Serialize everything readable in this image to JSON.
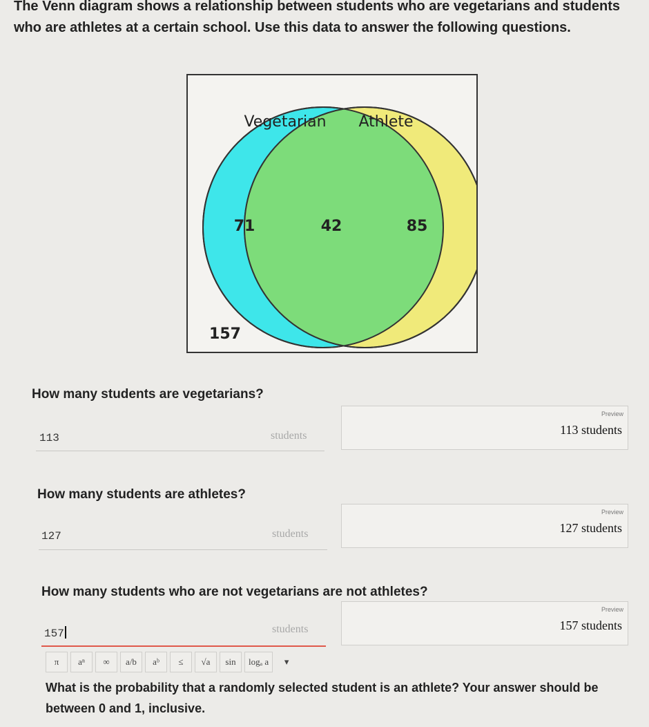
{
  "intro": "The Venn diagram shows a relationship between students who are vegetarians and students who are athletes at a certain school. Use this data to answer the following questions.",
  "venn": {
    "set_a_label": "Vegetarian",
    "set_b_label": "Athlete",
    "only_a": "71",
    "both": "42",
    "only_b": "85",
    "neither": "157",
    "color_a": "#3ee6ea",
    "color_b": "#f0ea7a",
    "color_overlap": "#7ddc7a"
  },
  "questions": [
    {
      "text": "How many students are vegetarians?",
      "value": "113",
      "unit": "students",
      "preview_label": "Preview",
      "preview_value": "113",
      "preview_unit": "students"
    },
    {
      "text": "How many students are athletes?",
      "value": "127",
      "unit": "students",
      "preview_label": "Preview",
      "preview_value": "127",
      "preview_unit": "students"
    },
    {
      "text": "How many students who are not vegetarians are not athletes?",
      "value": "157",
      "unit": "students",
      "preview_label": "Preview",
      "preview_value": "157",
      "preview_unit": "students"
    }
  ],
  "toolbar": {
    "buttons": [
      "π",
      "aⁿ",
      "∞",
      "a/b",
      "aᵇ",
      "≤",
      "√a",
      "sin",
      "logₐ a",
      "▾"
    ]
  },
  "last_question": "What is the probability that a randomly selected student is an athlete? Your answer should be between 0 and 1, inclusive."
}
